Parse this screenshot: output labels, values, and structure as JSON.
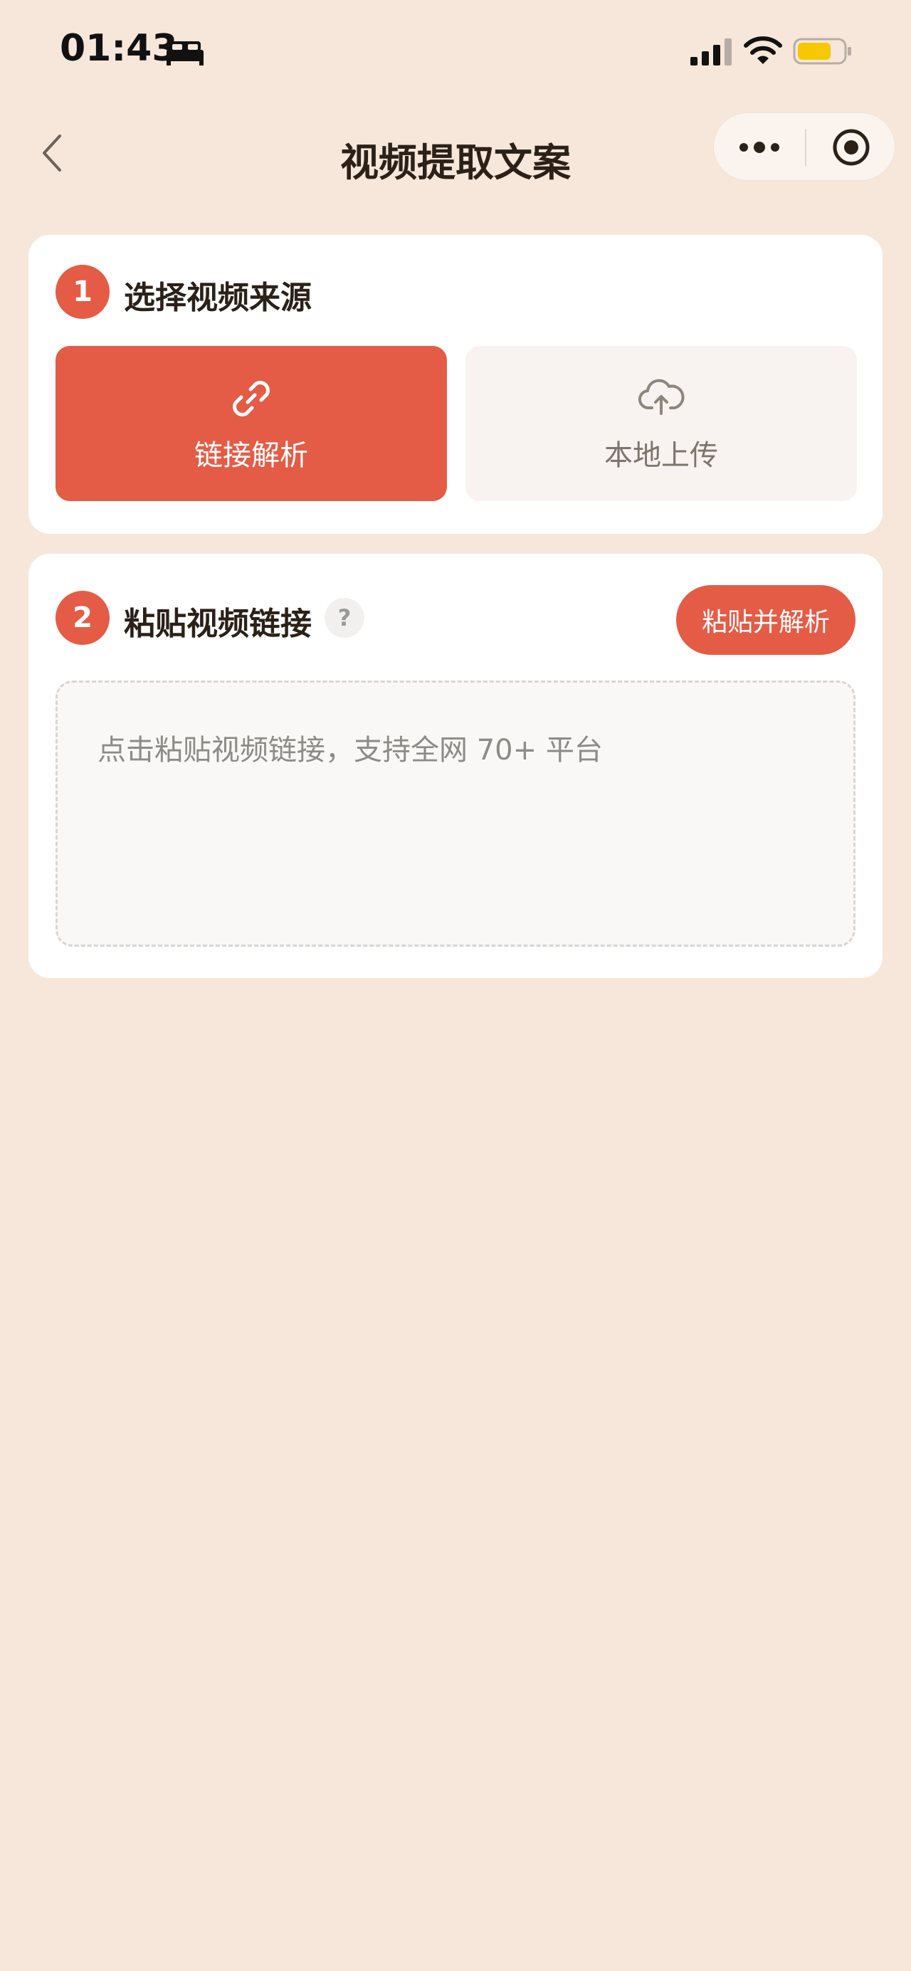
{
  "status_bar": {
    "time": "01:43",
    "icons": [
      "sleep-icon",
      "cellular-signal-icon",
      "wifi-icon",
      "battery-icon"
    ],
    "battery_color": "#f7c800"
  },
  "nav": {
    "title": "视频提取文案",
    "back_icon": "chevron-left-icon",
    "capsule_icons": [
      "more-dots-icon",
      "target-close-icon"
    ]
  },
  "step1": {
    "badge": "1",
    "title": "选择视频来源",
    "options": [
      {
        "label": "链接解析",
        "icon": "link-icon",
        "selected": true
      },
      {
        "label": "本地上传",
        "icon": "cloud-upload-icon",
        "selected": false
      }
    ]
  },
  "step2": {
    "badge": "2",
    "title": "粘贴视频链接",
    "help_symbol": "?",
    "paste_button_label": "粘贴并解析",
    "input_placeholder": "点击粘贴视频链接，支持全网 70+ 平台"
  },
  "colors": {
    "background": "#f7e7da",
    "accent": "#e45c46",
    "card": "#ffffff"
  }
}
